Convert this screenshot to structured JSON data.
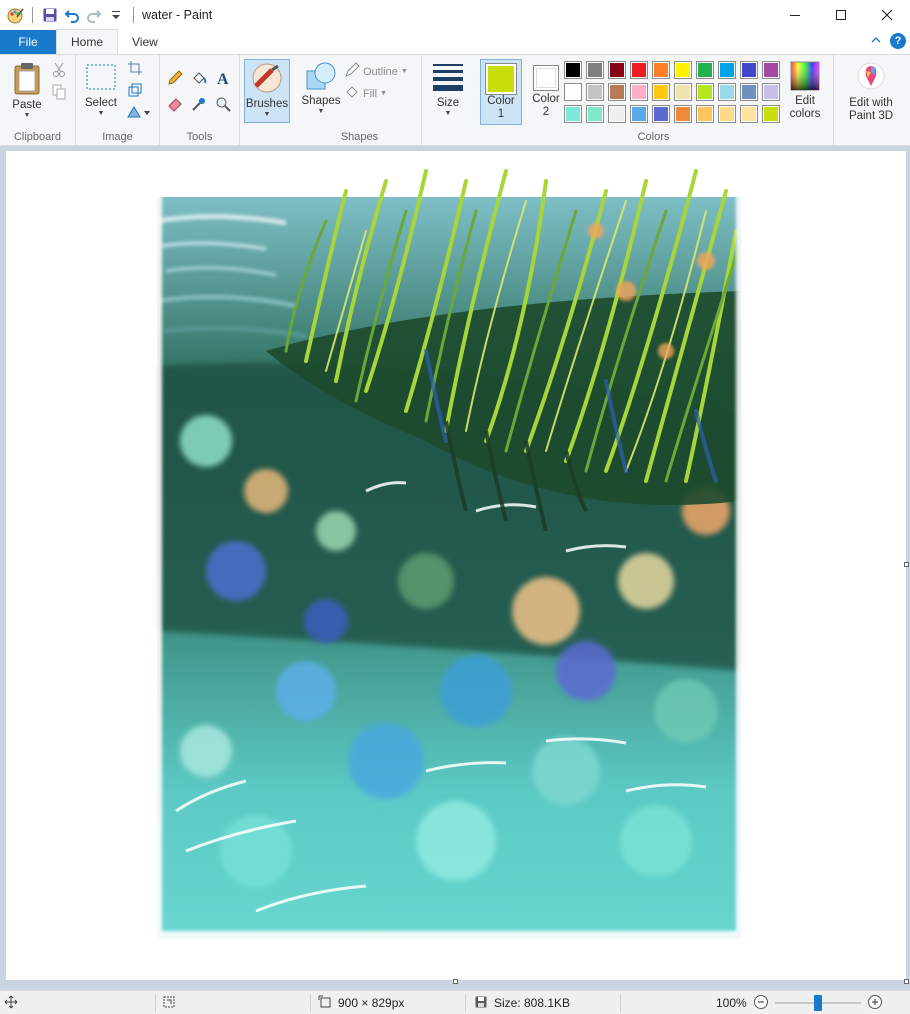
{
  "window": {
    "title": "water - Paint"
  },
  "tabs": {
    "file": "File",
    "home": "Home",
    "view": "View",
    "help": "?"
  },
  "groups": {
    "clipboard": {
      "label": "Clipboard",
      "paste": "Paste"
    },
    "image": {
      "label": "Image",
      "select": "Select"
    },
    "tools": {
      "label": "Tools"
    },
    "brushes": {
      "label": "Brushes"
    },
    "shapes": {
      "label": "Shapes",
      "shapes": "Shapes",
      "outline": "Outline",
      "fill": "Fill"
    },
    "size": {
      "label": "Size"
    },
    "colors": {
      "label": "Colors",
      "color1": "Color",
      "color1_num": "1",
      "color2": "Color",
      "color2_num": "2",
      "edit_colors_1": "Edit",
      "edit_colors_2": "colors",
      "paint3d_1": "Edit with",
      "paint3d_2": "Paint 3D",
      "color1_value": "#c8dd0a",
      "color2_value": "#ffffff",
      "palette": [
        [
          "#000000",
          "#7f7f7f",
          "#880015",
          "#ed1c24",
          "#ff7f27",
          "#fff200",
          "#22b14c",
          "#00a2e8",
          "#3f48cc",
          "#a349a4"
        ],
        [
          "#ffffff",
          "#c3c3c3",
          "#b97a57",
          "#ffaec9",
          "#ffc90e",
          "#efe4b0",
          "#b5e61d",
          "#99d9ea",
          "#7092be",
          "#c8bfe7"
        ],
        [
          "#7de8d8",
          "#7ee8c8",
          "#f0f0f0",
          "#5aa9ea",
          "#5b6ad0",
          "#f08a3a",
          "#ffc45a",
          "#ffd98a",
          "#ffe3a0",
          "#c8dd0a"
        ]
      ]
    }
  },
  "status": {
    "canvas_size": "900 × 829px",
    "file_size": "Size: 808.1KB",
    "zoom": "100%",
    "zoom_level": 0.5
  }
}
